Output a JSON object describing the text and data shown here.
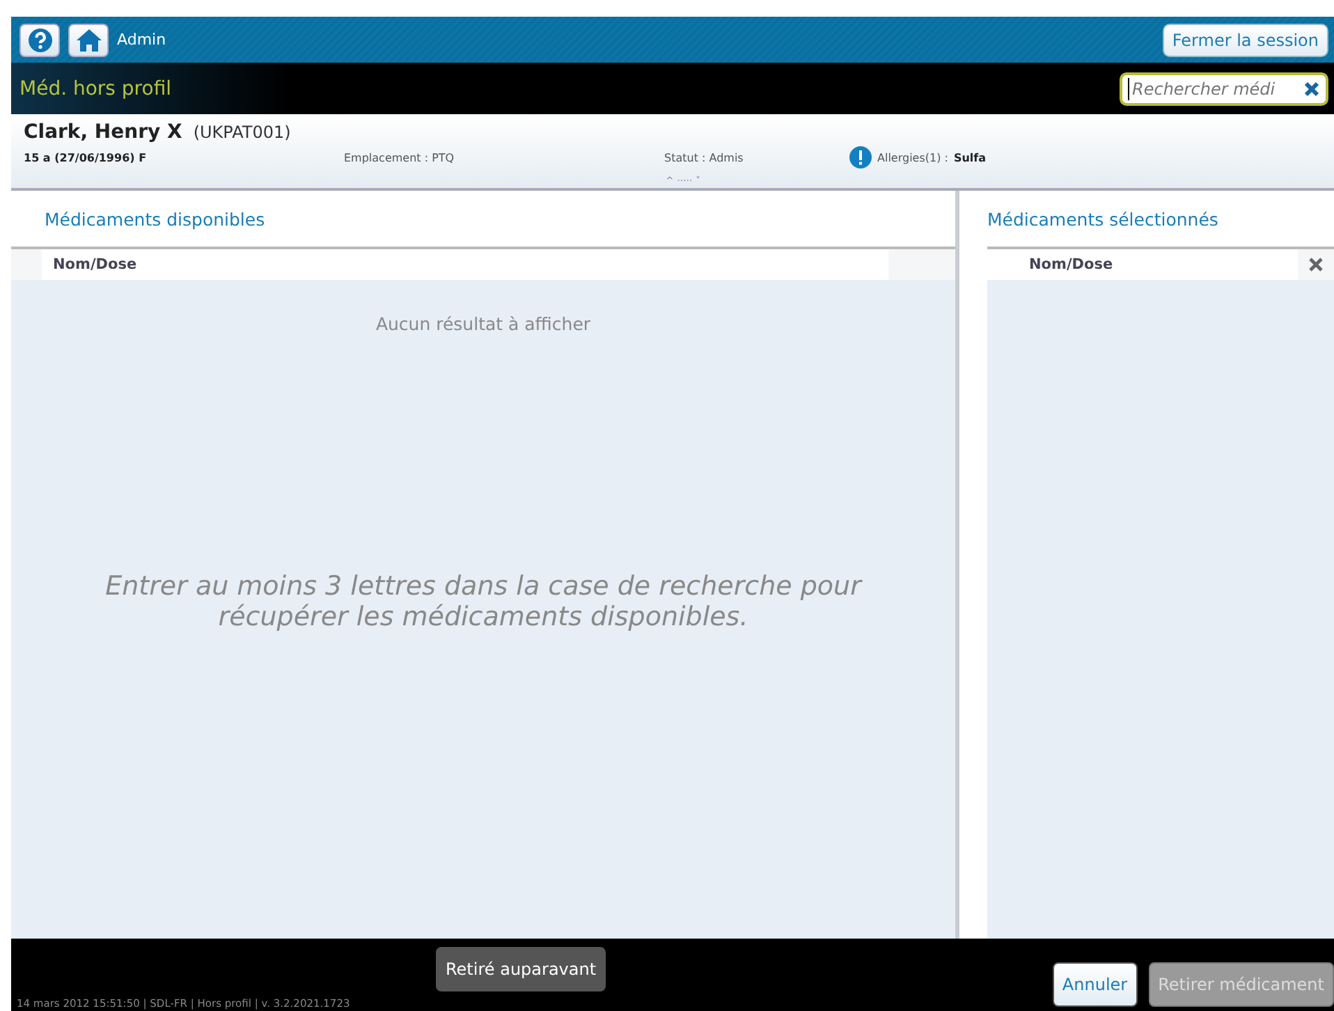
{
  "top_bar": {
    "user": "Admin",
    "logout_button": "Fermer la session"
  },
  "title_bar": {
    "title": "Méd. hors profil",
    "search": {
      "placeholder": "Rechercher médi"
    }
  },
  "patient": {
    "name": "Clark, Henry X",
    "id": "(UKPAT001)",
    "age_dob_sex": "15 a (27/06/1996) F",
    "location": "Emplacement : PTQ",
    "status": "Statut : Admis",
    "allergies_label": "Allergies(1) :",
    "allergies_value": "Sulfa",
    "expander": "^ ····· ˅"
  },
  "available": {
    "heading": "Médicaments disponibles",
    "column": "Nom/Dose",
    "no_results": "Aucun résultat à afficher",
    "hint": "Entrer au moins 3 lettres dans la case de recherche pour récupérer les médicaments disponibles."
  },
  "selected": {
    "heading": "Médicaments sélectionnés",
    "column": "Nom/Dose"
  },
  "footer": {
    "buttons": [
      {
        "label": "Retiré auparavant",
        "kind": "dark",
        "disabled": false
      },
      {
        "label": "Annuler",
        "kind": "light",
        "disabled": false
      },
      {
        "label": "Retirer médicament",
        "kind": "light",
        "disabled": true
      }
    ],
    "status": "14 mars 2012 15:51:50 | SDL-FR | Hors profil | v. 3.2.2021.1723"
  }
}
